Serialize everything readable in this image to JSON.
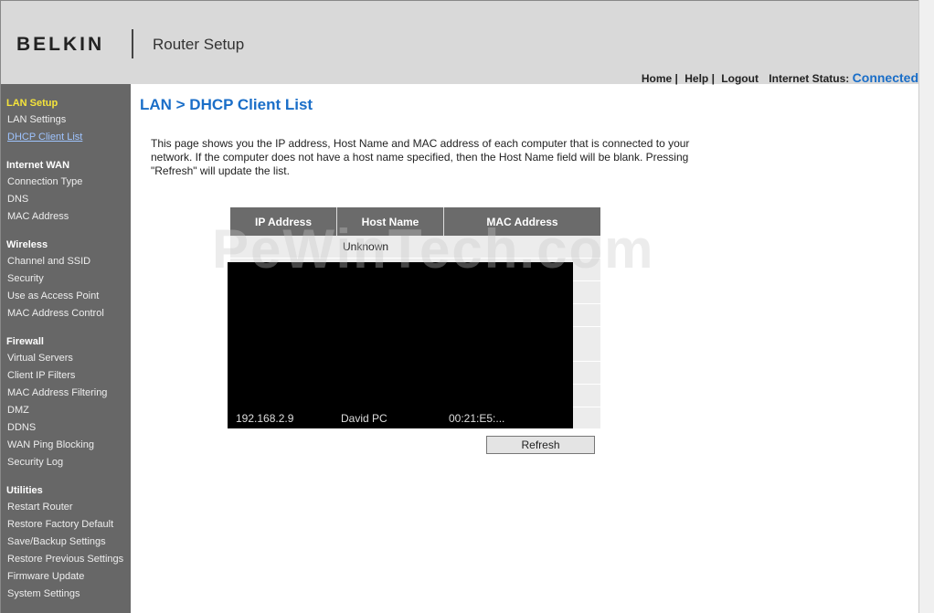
{
  "header": {
    "logo": "BELKIN",
    "app_title": "Router Setup",
    "nav": {
      "home": "Home",
      "help": "Help",
      "logout": "Logout",
      "status_label": "Internet Status:",
      "status_value": "Connected",
      "sep": "|"
    }
  },
  "sidebar": {
    "lan_setup": "LAN Setup",
    "lan_settings": "LAN Settings",
    "dhcp_client_list": "DHCP Client List",
    "internet_wan": "Internet WAN",
    "connection_type": "Connection Type",
    "dns": "DNS",
    "mac_address": "MAC Address",
    "wireless": "Wireless",
    "channel_ssid": "Channel and SSID",
    "security": "Security",
    "use_as_ap": "Use as Access Point",
    "mac_address_control": "MAC Address Control",
    "firewall": "Firewall",
    "virtual_servers": "Virtual Servers",
    "client_ip_filters": "Client IP Filters",
    "mac_address_filtering": "MAC Address Filtering",
    "dmz": "DMZ",
    "ddns": "DDNS",
    "wan_ping_blocking": "WAN Ping Blocking",
    "security_log": "Security Log",
    "utilities": "Utilities",
    "restart_router": "Restart Router",
    "restore_factory": "Restore Factory Default",
    "save_backup": "Save/Backup Settings",
    "restore_previous": "Restore Previous Settings",
    "firmware_update": "Firmware Update",
    "system_settings": "System Settings"
  },
  "main": {
    "title": "LAN > DHCP Client List",
    "description": "This page shows you the IP address, Host Name and MAC address of each computer that is connected to your network. If the computer does not have a host name specified, then the Host Name field will be blank. Pressing \"Refresh\" will update the list.",
    "columns": {
      "ip": "IP Address",
      "host": "Host Name",
      "mac": "MAC Address"
    },
    "rows": [
      {
        "host": "Unknown"
      }
    ],
    "last_row": {
      "ip": "192.168.2.9",
      "host": "David PC",
      "mac": "00:21:E5:..."
    },
    "refresh_label": "Refresh"
  },
  "watermark": "PeWinTech.com"
}
